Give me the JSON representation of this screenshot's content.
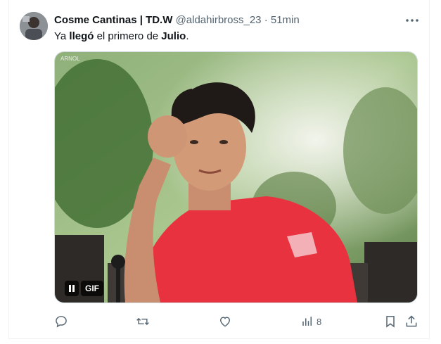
{
  "tweet": {
    "author_name": "Cosme Cantinas | TD.W",
    "handle": "@aldahirbross_23",
    "separator": "·",
    "time": "51min",
    "text_before": "Ya ",
    "text_bold1": "llegó",
    "text_middle": " el primero de ",
    "text_bold2": "Julio",
    "text_after": "."
  },
  "media": {
    "badge": "GIF",
    "watermark": "ARNOL"
  },
  "actions": {
    "views_count": "8"
  },
  "icons": [
    "more-icon",
    "reply-icon",
    "retweet-icon",
    "like-icon",
    "views-icon",
    "bookmark-icon",
    "share-icon",
    "pause-icon"
  ],
  "colors": {
    "text": "#0f1419",
    "secondary": "#536471",
    "shirt": "#e8323f",
    "border": "#cfd9de"
  }
}
